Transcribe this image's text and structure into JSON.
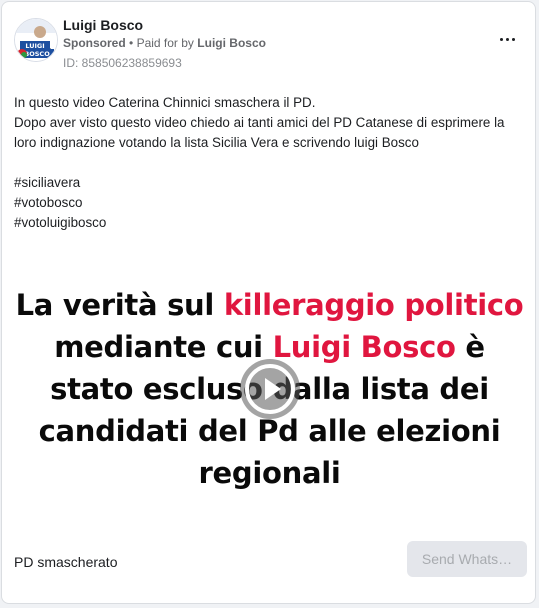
{
  "ad": {
    "page_name": "Luigi Bosco",
    "sponsored_label": "Sponsored",
    "separator": "•",
    "paid_for_prefix": "Paid for by",
    "paid_for_name": "Luigi Bosco",
    "ad_id": "ID: 858506238859693",
    "avatar": {
      "caption": "LUIGI BOSCO",
      "colors": {
        "blue": "#1d4fa0",
        "red": "#d8262e",
        "green": "#2b9a3e"
      }
    }
  },
  "body": {
    "lines": [
      "In questo video Caterina Chinnici smaschera il PD.",
      "Dopo aver visto questo video chiedo ai tanti amici del PD Catanese di esprimere la",
      "loro indignazione votando la lista Sicilia Vera e scrivendo luigi Bosco"
    ],
    "hashtags": [
      "#siciliavera",
      "#votobosco",
      "#votoluigibosco"
    ]
  },
  "media": {
    "headline": {
      "l1a": "La verità sul ",
      "l1b": "killeraggio politico",
      "l2a": "mediante cui ",
      "l2b": "Luigi Bosco",
      "l2c": " è",
      "l3": "stato escluso dalla lista dei",
      "l4": "candidati del Pd alle elezioni",
      "l5": "regionali"
    },
    "accent_color": "#e0163f",
    "play_icon": "play-icon"
  },
  "footer": {
    "caption": "PD smascherato",
    "cta_label": "Send Whats…"
  }
}
